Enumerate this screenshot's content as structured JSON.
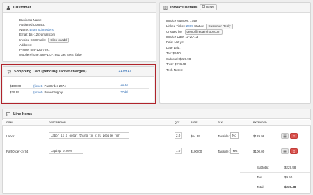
{
  "customer": {
    "title": "Customer",
    "business_name_label": "Business Name:",
    "assigned_contact_label": "Assigned Contact:",
    "name_label": "Name:",
    "name_value": "Brian Schneiders",
    "email_label": "Email:",
    "email_value": "bs+12@gmail.com",
    "invoice_cc_label": "Invoice CC Emails:",
    "click_to_add": "Click to add",
    "address_label": "Address:",
    "phone_label": "Phone:",
    "phone_value": "559-123-7891",
    "mobile_label": "Mobile Phone:",
    "mobile_value": "589-123-7891 Get SMS: false"
  },
  "invoice": {
    "title": "Invoice Details",
    "change_button": "Change",
    "number": "Invoice Number: 1749",
    "linked_ticket_label": "Linked Ticket:",
    "linked_ticket_value": "2069",
    "status_label": "Status:",
    "status_value": "Customer Reply",
    "created_by_label": "Created by:",
    "created_by_value": "demo@repairshopr.com",
    "invoice_date": "Invoice Date: 11-20-13",
    "paid": "Paid: Not yet",
    "date_paid": "Date paid:",
    "tax": "Tax: $9.50",
    "subtotal": "Subtotal: $229.98",
    "total": "Total: $239.48",
    "tech_notes": "Tech Notes:"
  },
  "cart": {
    "title": "Shopping Cart (pending Ticket charges)",
    "add_all": "Add All",
    "items": [
      {
        "price": "$100.00",
        "ticket": "(ticket)",
        "name": "PartOrder-2474",
        "add": "Add"
      },
      {
        "price": "$29.99",
        "ticket": "(ticket)",
        "name": "PowerSupply",
        "add": "Add"
      }
    ]
  },
  "line_items": {
    "title": "Line Items",
    "headers": {
      "item": "ITEM",
      "description": "DESCRIPTION",
      "qty": "QTY",
      "rate": "RATE",
      "tax": "TAX",
      "extended": "EXTENDED"
    },
    "rows": [
      {
        "item": "Labor",
        "description": "Labor is a great thing to bill people for",
        "qty": "2.0",
        "rate": "$64.99",
        "taxable_label": "Taxable:",
        "taxable": "No",
        "extended": "$129.98"
      },
      {
        "item": "PartOrder-2474",
        "description": "Laptop screen",
        "qty": "1.0",
        "rate": "$100.00",
        "taxable_label": "Taxable:",
        "taxable": "Yes",
        "extended": "$100.00"
      }
    ],
    "totals": {
      "subtotal_label": "Subtotal:",
      "subtotal": "$229.98",
      "tax_label": "Tax:",
      "tax": "$9.50",
      "total_label": "Total:",
      "total": "$239.48"
    }
  }
}
